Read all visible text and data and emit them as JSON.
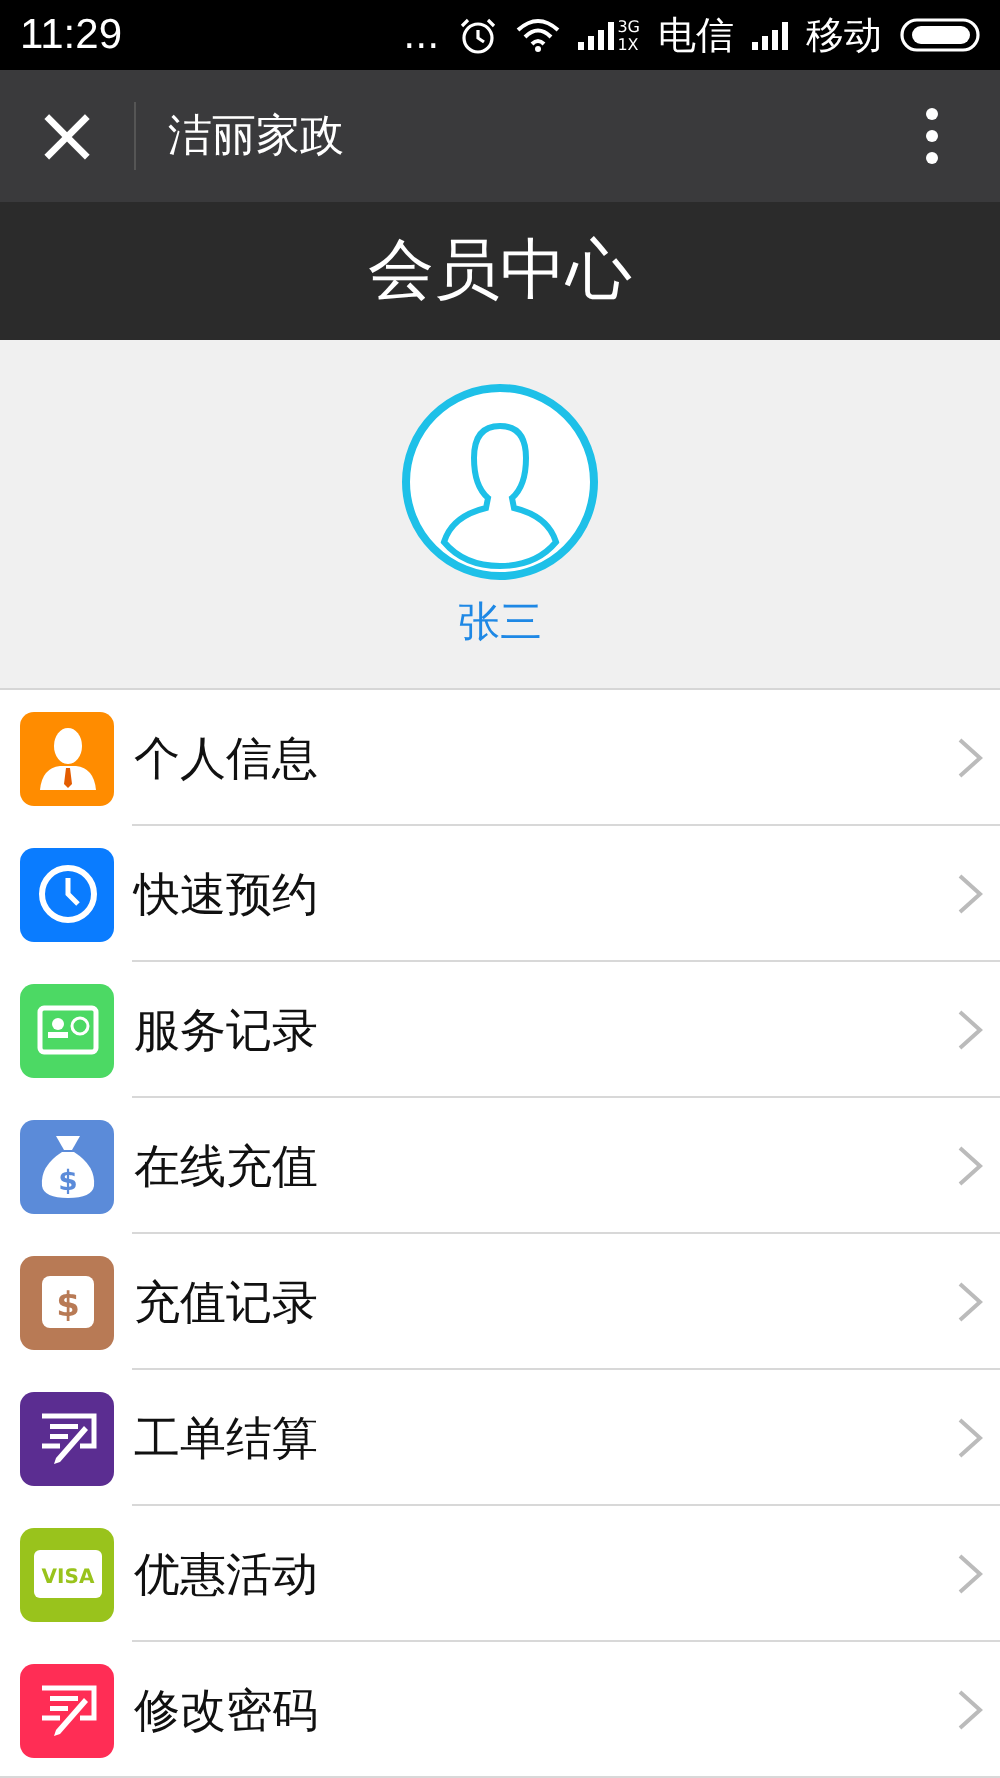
{
  "status_bar": {
    "time": "11:29",
    "dots": "...",
    "network_top": "3G",
    "network_bottom": "1X",
    "carrier_1": "电信",
    "carrier_2": "移动"
  },
  "app_bar": {
    "close": "×",
    "title": "洁丽家政"
  },
  "header": {
    "title": "会员中心"
  },
  "profile": {
    "name": "张三"
  },
  "menu": [
    {
      "label": "个人信息",
      "kind": "person",
      "color": "#ff8c00"
    },
    {
      "label": "快速预约",
      "kind": "clock",
      "color": "#0a7cff"
    },
    {
      "label": "服务记录",
      "kind": "card",
      "color": "#4cd964"
    },
    {
      "label": "在线充值",
      "kind": "bag",
      "color": "#5b8bd9",
      "icon_text": "$"
    },
    {
      "label": "充值记录",
      "kind": "dollar",
      "color": "#b87a55",
      "icon_text": "$"
    },
    {
      "label": "工单结算",
      "kind": "pen",
      "color": "#5b2d91"
    },
    {
      "label": "优惠活动",
      "kind": "visa",
      "color": "#99c31c",
      "icon_text": "VISA"
    },
    {
      "label": "修改密码",
      "kind": "pen",
      "color": "#ff2d55"
    }
  ]
}
